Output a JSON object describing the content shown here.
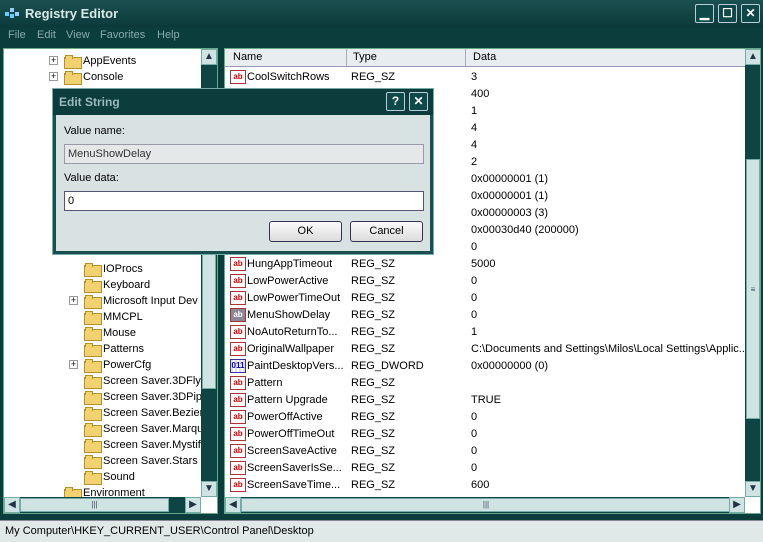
{
  "window": {
    "title": "Registry Editor"
  },
  "menu": [
    "File",
    "Edit",
    "View",
    "Favorites",
    "Help"
  ],
  "tree": {
    "items": [
      {
        "label": "AppEvents",
        "expander": "+"
      },
      {
        "label": "Console",
        "expander": "+"
      },
      {
        "label": "IOProcs",
        "expander": ""
      },
      {
        "label": "Keyboard",
        "expander": ""
      },
      {
        "label": "Microsoft Input Dev",
        "expander": "+"
      },
      {
        "label": "MMCPL",
        "expander": ""
      },
      {
        "label": "Mouse",
        "expander": ""
      },
      {
        "label": "Patterns",
        "expander": ""
      },
      {
        "label": "PowerCfg",
        "expander": "+"
      },
      {
        "label": "Screen Saver.3DFly",
        "expander": ""
      },
      {
        "label": "Screen Saver.3DPip",
        "expander": ""
      },
      {
        "label": "Screen Saver.Bezier",
        "expander": ""
      },
      {
        "label": "Screen Saver.Marqu",
        "expander": ""
      },
      {
        "label": "Screen Saver.Mystif",
        "expander": ""
      },
      {
        "label": "Screen Saver.Stars",
        "expander": ""
      },
      {
        "label": "Sound",
        "expander": ""
      },
      {
        "label": "Environment",
        "expander": ""
      }
    ]
  },
  "list": {
    "columns": [
      "Name",
      "Type",
      "Data"
    ],
    "rows": [
      {
        "name": "CoolSwitchRows",
        "type": "REG_SZ",
        "data": "3",
        "icon": "string"
      },
      {
        "name": "",
        "type": "",
        "data": "400",
        "icon": ""
      },
      {
        "name": "",
        "type": "",
        "data": "1",
        "icon": ""
      },
      {
        "name": "",
        "type": "",
        "data": "4",
        "icon": ""
      },
      {
        "name": "",
        "type": "",
        "data": "4",
        "icon": ""
      },
      {
        "name": "",
        "type": "",
        "data": "2",
        "icon": ""
      },
      {
        "name": "",
        "type": "",
        "data": "0x00000001 (1)",
        "icon": ""
      },
      {
        "name": "",
        "type": "",
        "data": "0x00000001 (1)",
        "icon": ""
      },
      {
        "name": "",
        "type": "",
        "data": "0x00000003 (3)",
        "icon": ""
      },
      {
        "name": "",
        "type": "",
        "data": "0x00030d40 (200000)",
        "icon": ""
      },
      {
        "name": "",
        "type": "",
        "data": "0",
        "icon": ""
      },
      {
        "name": "HungAppTimeout",
        "type": "REG_SZ",
        "data": "5000",
        "icon": "string"
      },
      {
        "name": "LowPowerActive",
        "type": "REG_SZ",
        "data": "0",
        "icon": "string"
      },
      {
        "name": "LowPowerTimeOut",
        "type": "REG_SZ",
        "data": "0",
        "icon": "string"
      },
      {
        "name": "MenuShowDelay",
        "type": "REG_SZ",
        "data": "0",
        "icon": "string-selected"
      },
      {
        "name": "NoAutoReturnTo...",
        "type": "REG_SZ",
        "data": "1",
        "icon": "string"
      },
      {
        "name": "OriginalWallpaper",
        "type": "REG_SZ",
        "data": "C:\\Documents and Settings\\Milos\\Local Settings\\Applic...",
        "icon": "string"
      },
      {
        "name": "PaintDesktopVers...",
        "type": "REG_DWORD",
        "data": "0x00000000 (0)",
        "icon": "dword"
      },
      {
        "name": "Pattern",
        "type": "REG_SZ",
        "data": "",
        "icon": "string"
      },
      {
        "name": "Pattern Upgrade",
        "type": "REG_SZ",
        "data": "TRUE",
        "icon": "string"
      },
      {
        "name": "PowerOffActive",
        "type": "REG_SZ",
        "data": "0",
        "icon": "string"
      },
      {
        "name": "PowerOffTimeOut",
        "type": "REG_SZ",
        "data": "0",
        "icon": "string"
      },
      {
        "name": "ScreenSaveActive",
        "type": "REG_SZ",
        "data": "0",
        "icon": "string"
      },
      {
        "name": "ScreenSaverIsSe...",
        "type": "REG_SZ",
        "data": "0",
        "icon": "string"
      },
      {
        "name": "ScreenSaveTime...",
        "type": "REG_SZ",
        "data": "600",
        "icon": "string"
      }
    ]
  },
  "status": {
    "path": "My Computer\\HKEY_CURRENT_USER\\Control Panel\\Desktop"
  },
  "dialog": {
    "title": "Edit String",
    "value_name_label": "Value name:",
    "value_name": "MenuShowDelay",
    "value_data_label": "Value data:",
    "value_data": "0",
    "ok_label": "OK",
    "cancel_label": "Cancel",
    "help_glyph": "?",
    "close_glyph": "✕"
  },
  "icons": {
    "string": "ab",
    "dword": "011"
  },
  "colors": {
    "titlebar": "#0c3a3a",
    "folder": "#f2d270"
  }
}
